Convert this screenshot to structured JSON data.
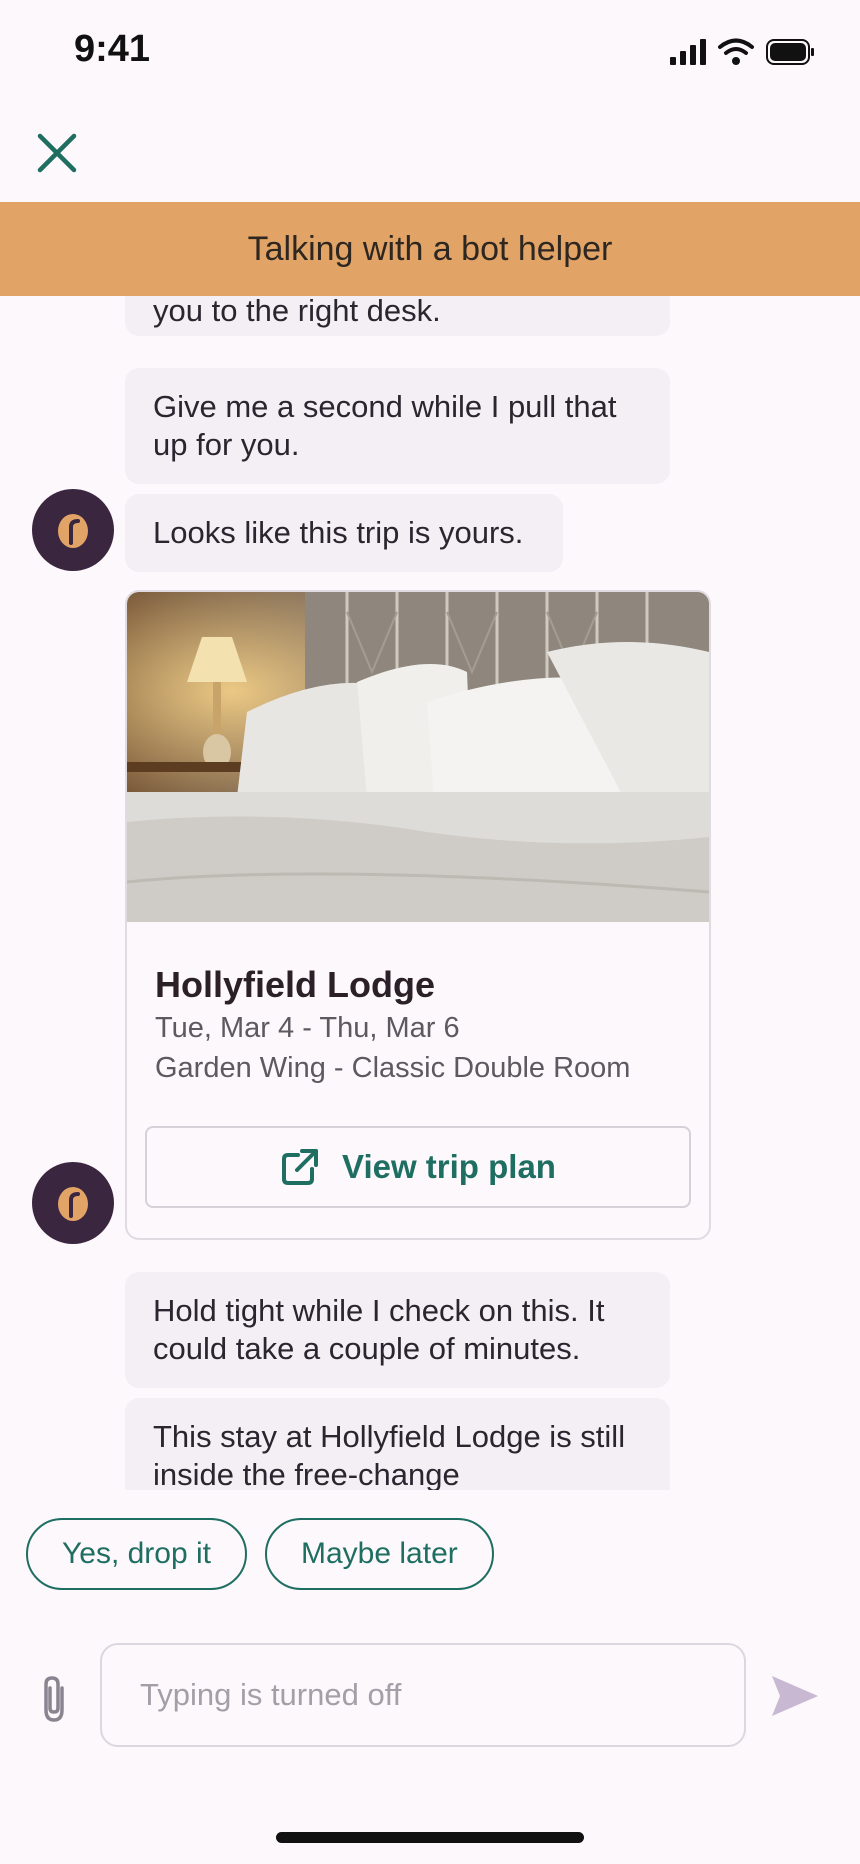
{
  "status_bar": {
    "time": "9:41"
  },
  "header": {
    "banner_text": "Talking with a bot helper"
  },
  "messages": [
    {
      "text": "you to the right desk."
    },
    {
      "text": "Give me a second while I pull that up for you."
    },
    {
      "text": "Looks like this trip is yours."
    },
    {
      "text": "Hold tight while I check on this. It could take a couple of minutes."
    },
    {
      "text": "This stay at Hollyfield Lodge is still inside the free-change"
    }
  ],
  "trip_card": {
    "hotel_name": "Hollyfield Lodge",
    "dates": "Tue, Mar 4 - Thu, Mar 6",
    "room": "Garden Wing - Classic Double Room",
    "button_label": "View trip plan"
  },
  "quick_replies": [
    "Yes, drop it",
    "Maybe later"
  ],
  "composer": {
    "placeholder": "Typing is turned off"
  },
  "colors": {
    "accent": "#1f6e62",
    "banner": "#e2a466",
    "avatar": "#3b2640",
    "bubble": "#f3eff4"
  }
}
